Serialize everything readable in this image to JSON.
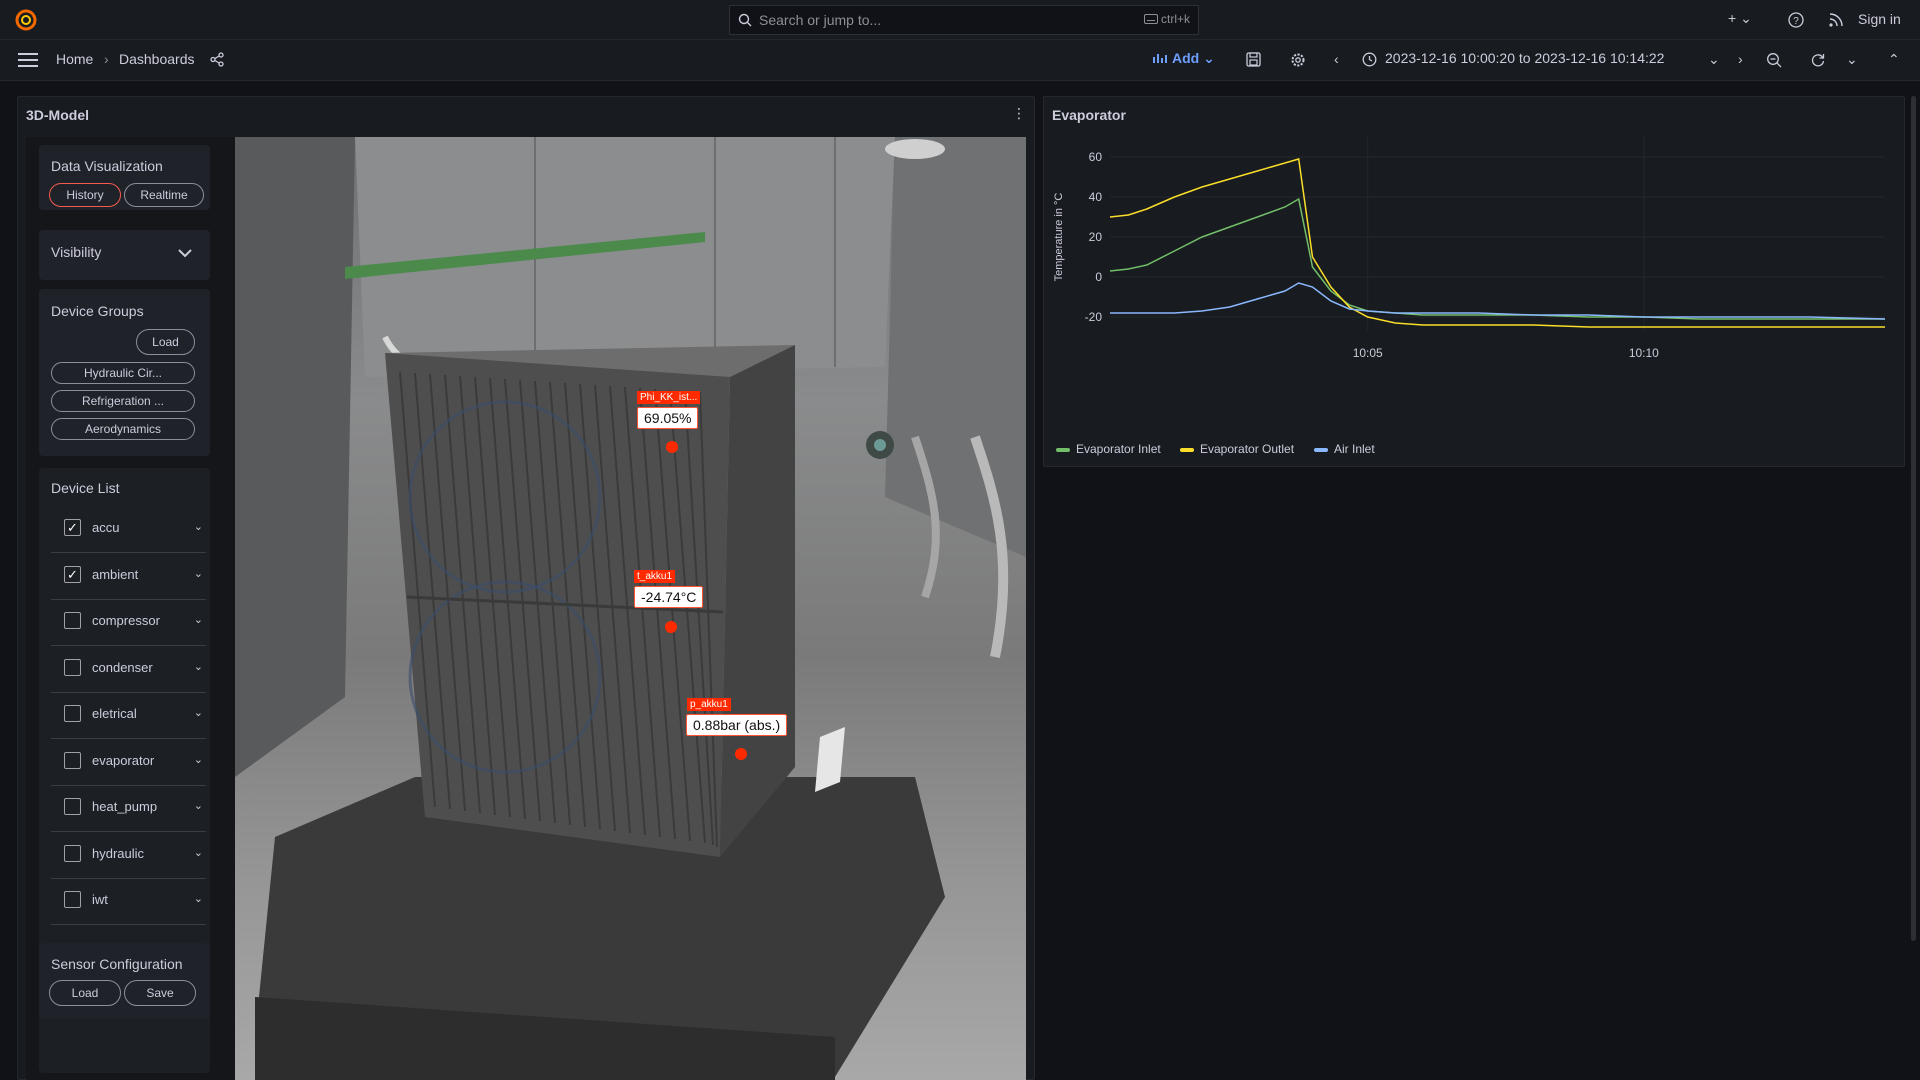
{
  "topbar": {
    "search_placeholder": "Search or jump to...",
    "search_shortcut": "ctrl+k",
    "sign_in": "Sign in"
  },
  "navbar": {
    "breadcrumb": [
      "Home",
      "Dashboards"
    ],
    "add_label": "Add",
    "time_range": "2023-12-16 10:00:20 to 2023-12-16 10:14:22"
  },
  "model_panel": {
    "title": "3D-Model",
    "data_visualization": {
      "title": "Data Visualization",
      "history": "History",
      "realtime": "Realtime",
      "active": "History"
    },
    "visibility": {
      "title": "Visibility"
    },
    "device_groups": {
      "title": "Device Groups",
      "load": "Load",
      "groups": [
        "Hydraulic Cir...",
        "Refrigeration ...",
        "Aerodynamics"
      ]
    },
    "device_list": {
      "title": "Device List",
      "items": [
        {
          "label": "accu",
          "checked": true
        },
        {
          "label": "ambient",
          "checked": true
        },
        {
          "label": "compressor",
          "checked": false
        },
        {
          "label": "condenser",
          "checked": false
        },
        {
          "label": "eletrical",
          "checked": false
        },
        {
          "label": "evaporator",
          "checked": false
        },
        {
          "label": "heat_pump",
          "checked": false
        },
        {
          "label": "hydraulic",
          "checked": false
        },
        {
          "label": "iwt",
          "checked": false
        }
      ]
    },
    "sensor_configuration": {
      "title": "Sensor Configuration",
      "load": "Load",
      "save": "Save"
    },
    "sensors": [
      {
        "tag": "Phi_KK_ist...",
        "value": "69.05%"
      },
      {
        "tag": "t_akku1",
        "value": "-24.74°C"
      },
      {
        "tag": "p_akku1",
        "value": "0.88bar (abs.)"
      }
    ]
  },
  "evaporator_panel": {
    "title": "Evaporator"
  },
  "chart_data": {
    "type": "line",
    "title": "Evaporator",
    "ylabel": "Temperature in °C",
    "xlabel": "",
    "ylim": [
      -27,
      67
    ],
    "yticks": [
      60,
      40,
      20,
      0,
      -20
    ],
    "xticks": [
      "10:05",
      "10:10"
    ],
    "xrange": [
      "10:00:20",
      "10:14:22"
    ],
    "grid": true,
    "legend": "bottom-left",
    "x": [
      "10:00:20",
      "10:00:40",
      "10:01:00",
      "10:01:30",
      "10:02:00",
      "10:02:30",
      "10:03:00",
      "10:03:30",
      "10:03:45",
      "10:04:00",
      "10:04:20",
      "10:04:40",
      "10:05:00",
      "10:05:30",
      "10:06:00",
      "10:07:00",
      "10:08:00",
      "10:09:00",
      "10:10:00",
      "10:11:00",
      "10:12:00",
      "10:13:00",
      "10:14:22"
    ],
    "series": [
      {
        "name": "Evaporator Inlet",
        "color": "#73bf69",
        "values": [
          3,
          4,
          6,
          13,
          20,
          25,
          30,
          35,
          39,
          5,
          -7,
          -14,
          -17,
          -18,
          -19,
          -19,
          -19,
          -20,
          -20,
          -21,
          -21,
          -21,
          -21
        ]
      },
      {
        "name": "Evaporator Outlet",
        "color": "#fade2a",
        "values": [
          30,
          31,
          34,
          40,
          45,
          49,
          53,
          57,
          59,
          10,
          -5,
          -15,
          -20,
          -23,
          -24,
          -24,
          -24,
          -25,
          -25,
          -25,
          -25,
          -25,
          -25
        ]
      },
      {
        "name": "Air Inlet",
        "color": "#8ab8ff",
        "values": [
          -18,
          -18,
          -18,
          -18,
          -17,
          -15,
          -11,
          -7,
          -3,
          -5,
          -12,
          -16,
          -17,
          -18,
          -18,
          -18,
          -19,
          -19,
          -20,
          -20,
          -20,
          -20,
          -21
        ]
      }
    ]
  },
  "colors": {
    "background": "#111217",
    "panel": "#181b1f",
    "accent_blue": "#6e9fff",
    "sensor_red": "#ff2a00"
  }
}
